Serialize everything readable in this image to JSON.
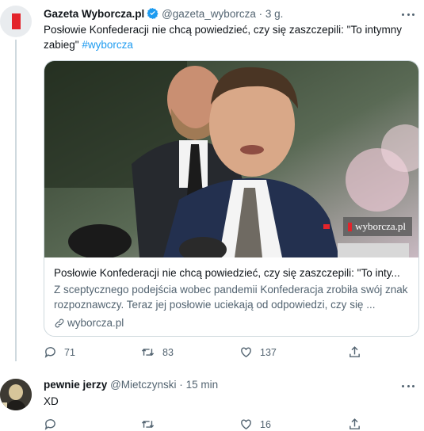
{
  "tweet1": {
    "display_name": "Gazeta Wyborcza.pl",
    "handle": "@gazeta_wyborcza",
    "separator": "·",
    "time": "3 g.",
    "text": "Posłowie Konfederacji nie chcą powiedzieć, czy się zaszczepili: \"To intymny zabieg\"",
    "hashtag": "#wyborcza",
    "card": {
      "watermark": "wyborcza.pl",
      "title": "Posłowie Konfederacji nie chcą powiedzieć, czy się zaszczepili: \"To inty...",
      "description": "Z sceptycznego podejścia wobec pandemii Konfederacja zrobiła swój znak rozpoznawczy. Teraz jej posłowie uciekają od odpowiedzi, czy się ...",
      "domain": "wyborcza.pl"
    },
    "actions": {
      "replies": "71",
      "retweets": "83",
      "likes": "137"
    }
  },
  "tweet2": {
    "display_name": "pewnie jerzy",
    "handle": "@Mietczynski",
    "separator": "·",
    "time": "15 min",
    "text": "XD",
    "actions": {
      "replies": "",
      "retweets": "",
      "likes": "16"
    }
  },
  "colors": {
    "accent": "#1d9bf0",
    "secondary_text": "#536471",
    "border": "#cfd9de",
    "brand_red": "#e3242b"
  }
}
